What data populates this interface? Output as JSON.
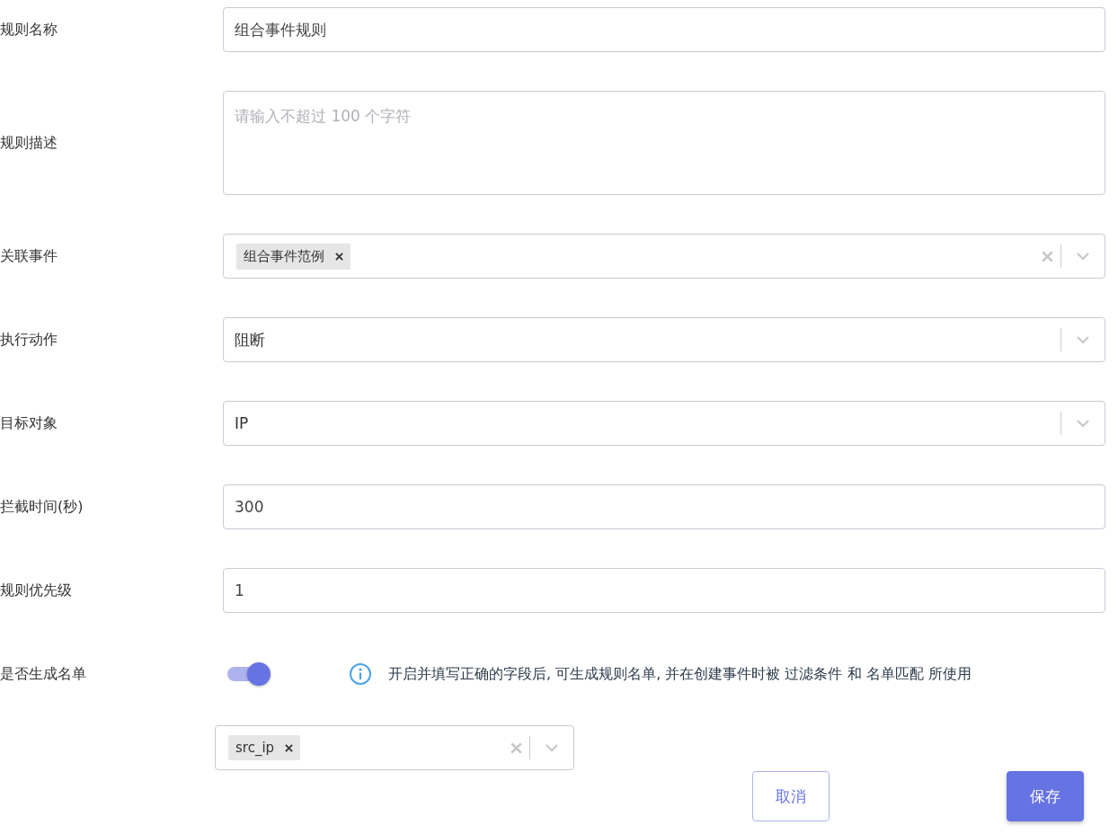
{
  "fields": [
    {
      "kind": "input",
      "label": "规则名称",
      "value": "组合事件规则"
    },
    {
      "kind": "textarea",
      "label": "规则描述",
      "placeholder": "请输入不超过 100 个字符"
    },
    {
      "kind": "multi",
      "label": "关联事件",
      "tags": [
        "组合事件范例"
      ]
    },
    {
      "kind": "select",
      "label": "执行动作",
      "value": "阻断"
    },
    {
      "kind": "select",
      "label": "目标对象",
      "value": "IP"
    },
    {
      "kind": "input",
      "label": "拦截时间(秒)",
      "value": "300"
    },
    {
      "kind": "input",
      "label": "规则优先级",
      "value": "1"
    },
    {
      "kind": "toggle",
      "label": "是否生成名单",
      "on": true,
      "info": "开启并填写正确的字段后, 可生成规则名单, 并在创建事件时被 过滤条件 和 名单匹配 所使用"
    }
  ],
  "list_select": {
    "tags": [
      "src_ip"
    ]
  },
  "buttons": [
    {
      "label": "取消",
      "kind": "secondary"
    },
    {
      "label": "保存",
      "kind": "primary"
    }
  ]
}
